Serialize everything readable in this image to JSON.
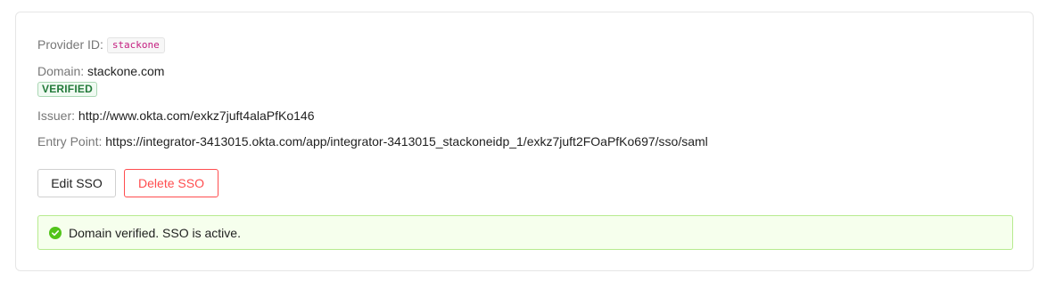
{
  "sso": {
    "provider_label": "Provider ID:",
    "provider_id": "stackone",
    "domain_label": "Domain:",
    "domain": "stackone.com",
    "status_badge": "VERIFIED",
    "issuer_label": "Issuer:",
    "issuer": "http://www.okta.com/exkz7juft4alaPfKo146",
    "entry_point_label": "Entry Point:",
    "entry_point": "https://integrator-3413015.okta.com/app/integrator-3413015_stackoneidp_1/exkz7juft2FOaPfKo697/sso/saml"
  },
  "actions": {
    "edit_label": "Edit SSO",
    "delete_label": "Delete SSO"
  },
  "alert": {
    "message": "Domain verified. SSO is active.",
    "icon": "check-circle-icon",
    "color": "#52c41a"
  },
  "colors": {
    "danger": "#ff4d4f",
    "success_bg": "#f6ffed",
    "success_border": "#b7eb8f",
    "code_text": "#c41d7f"
  }
}
